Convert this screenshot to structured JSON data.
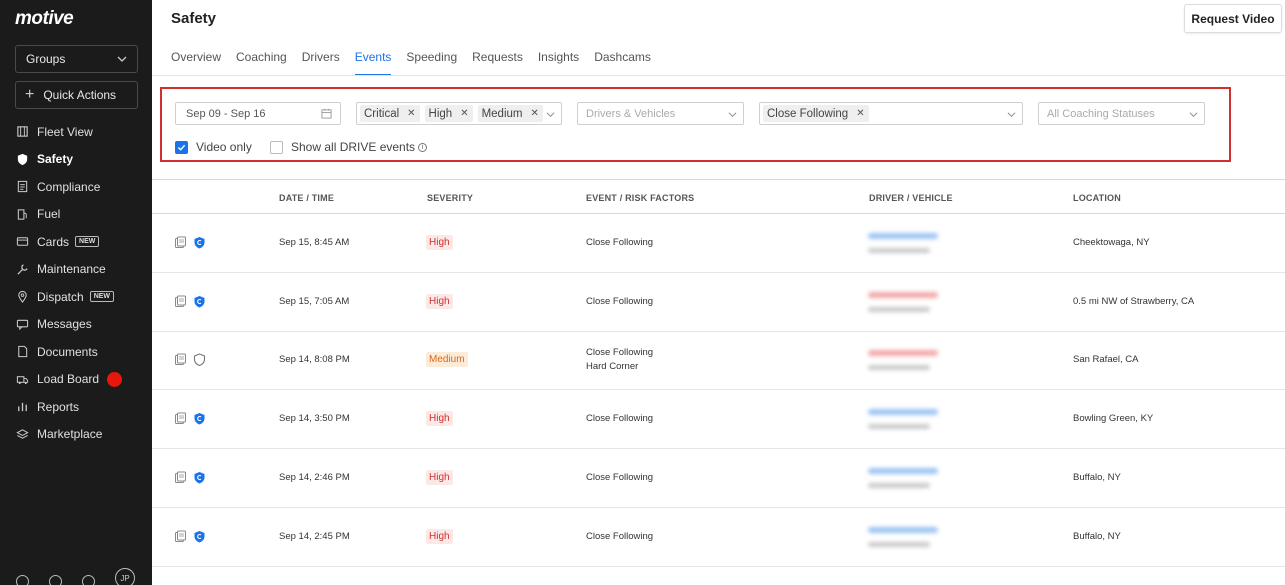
{
  "sidebar": {
    "logo": "motive",
    "groups_label": "Groups",
    "quick_actions_label": "Quick Actions",
    "items": [
      {
        "label": "Fleet View",
        "icon": "map-icon"
      },
      {
        "label": "Safety",
        "icon": "shield-icon",
        "active": true
      },
      {
        "label": "Compliance",
        "icon": "document-list-icon"
      },
      {
        "label": "Fuel",
        "icon": "fuel-pump-icon"
      },
      {
        "label": "Cards",
        "icon": "card-icon",
        "badge": "NEW"
      },
      {
        "label": "Maintenance",
        "icon": "wrench-icon"
      },
      {
        "label": "Dispatch",
        "icon": "location-pin-icon",
        "badge": "NEW"
      },
      {
        "label": "Messages",
        "icon": "chat-icon"
      },
      {
        "label": "Documents",
        "icon": "file-icon"
      },
      {
        "label": "Load Board",
        "icon": "truck-icon",
        "notification_dot": true
      },
      {
        "label": "Reports",
        "icon": "bar-chart-icon"
      },
      {
        "label": "Marketplace",
        "icon": "layers-icon"
      }
    ],
    "avatar_initials": "JP"
  },
  "header": {
    "title": "Safety",
    "request_video_label": "Request Video",
    "tabs": [
      "Overview",
      "Coaching",
      "Drivers",
      "Events",
      "Speeding",
      "Requests",
      "Insights",
      "Dashcams"
    ],
    "active_tab": "Events"
  },
  "filters": {
    "date_range": "Sep 09 - Sep 16",
    "severity_chips": [
      "Critical",
      "High",
      "Medium"
    ],
    "drivers_placeholder": "Drivers & Vehicles",
    "event_type_chips": [
      "Close Following"
    ],
    "coaching_placeholder": "All Coaching Statuses",
    "video_only_label": "Video only",
    "video_only_checked": true,
    "show_drive_label": "Show all DRIVE events",
    "show_drive_checked": false
  },
  "table": {
    "headers": [
      "DATE / TIME",
      "SEVERITY",
      "EVENT / RISK FACTORS",
      "DRIVER / VEHICLE",
      "LOCATION"
    ],
    "rows": [
      {
        "datetime": "Sep 15, 8:45 AM",
        "severity": "High",
        "events": [
          "Close Following"
        ],
        "location": "Cheektowaga, NY",
        "shield": "blue",
        "driver_color": "#9cc4f2"
      },
      {
        "datetime": "Sep 15, 7:05 AM",
        "severity": "High",
        "events": [
          "Close Following"
        ],
        "location": "0.5 mi NW of Strawberry, CA",
        "shield": "blue",
        "driver_color": "#f2a8a8"
      },
      {
        "datetime": "Sep 14, 8:08 PM",
        "severity": "Medium",
        "events": [
          "Close Following",
          "Hard Corner"
        ],
        "location": "San Rafael, CA",
        "shield": "outline",
        "driver_color": "#f2a8a8"
      },
      {
        "datetime": "Sep 14, 3:50 PM",
        "severity": "High",
        "events": [
          "Close Following"
        ],
        "location": "Bowling Green, KY",
        "shield": "blue",
        "driver_color": "#9cc4f2"
      },
      {
        "datetime": "Sep 14, 2:46 PM",
        "severity": "High",
        "events": [
          "Close Following"
        ],
        "location": "Buffalo, NY",
        "shield": "blue",
        "driver_color": "#9cc4f2"
      },
      {
        "datetime": "Sep 14, 2:45 PM",
        "severity": "High",
        "events": [
          "Close Following"
        ],
        "location": "Buffalo, NY",
        "shield": "blue",
        "driver_color": "#9cc4f2"
      }
    ]
  },
  "colors": {
    "accent": "#1a73e8",
    "highlight_border": "#d0312d",
    "high": "#d0312d",
    "medium": "#d86a1a"
  }
}
